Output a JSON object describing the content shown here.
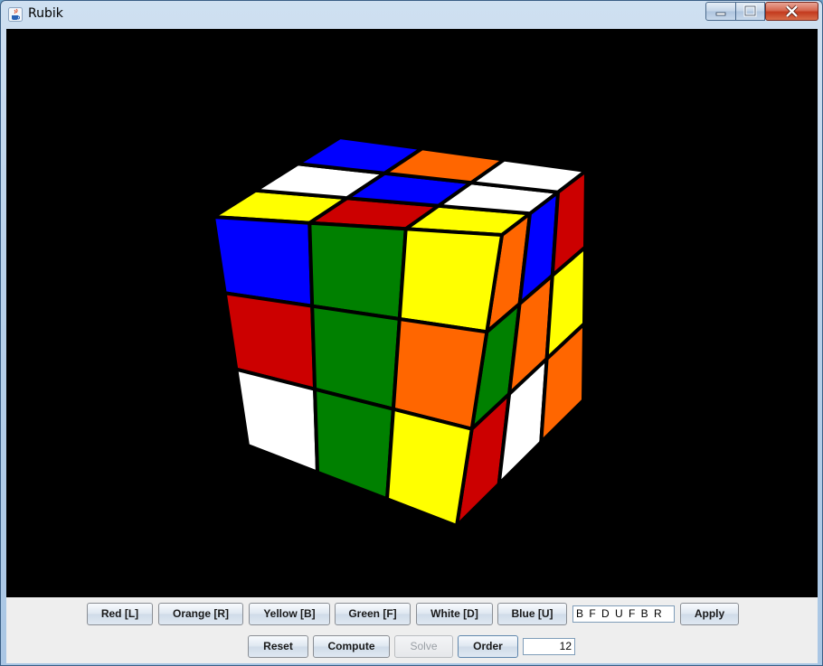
{
  "window": {
    "title": "Rubik"
  },
  "colors": {
    "red": "#cc0000",
    "orange": "#ff6600",
    "yellow": "#ffff00",
    "green": "#008000",
    "white": "#ffffff",
    "blue": "#0000ff",
    "background": "#000000"
  },
  "cube": {
    "up": [
      [
        "yellow",
        "white",
        "blue"
      ],
      [
        "red",
        "blue",
        "orange"
      ],
      [
        "yellow",
        "white",
        "white"
      ]
    ],
    "front": [
      [
        "blue",
        "green",
        "yellow"
      ],
      [
        "red",
        "green",
        "orange"
      ],
      [
        "white",
        "green",
        "yellow"
      ]
    ],
    "right": [
      [
        "orange",
        "blue",
        "red"
      ],
      [
        "green",
        "orange",
        "yellow"
      ],
      [
        "red",
        "white",
        "orange"
      ]
    ]
  },
  "controls": {
    "row1": [
      {
        "key": "red",
        "label": "Red [L]"
      },
      {
        "key": "orange",
        "label": "Orange [R]"
      },
      {
        "key": "yellow",
        "label": "Yellow [B]"
      },
      {
        "key": "green",
        "label": "Green [F]"
      },
      {
        "key": "white",
        "label": "White [D]"
      },
      {
        "key": "blue",
        "label": "Blue [U]"
      }
    ],
    "moves_value": "B F D U F B R",
    "apply_label": "Apply",
    "reset_label": "Reset",
    "compute_label": "Compute",
    "solve_label": "Solve",
    "order_label": "Order",
    "order_value": "12"
  }
}
